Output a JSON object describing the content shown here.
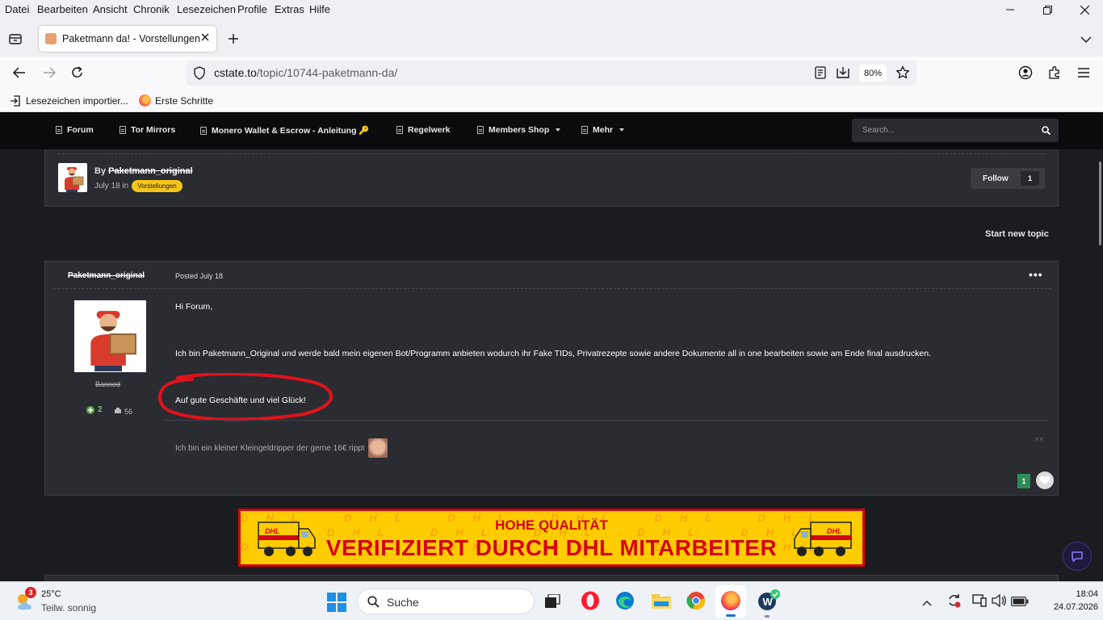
{
  "browser": {
    "menu": [
      "Datei",
      "Bearbeiten",
      "Ansicht",
      "Chronik",
      "Lesezeichen",
      "Profile",
      "Extras",
      "Hilfe"
    ],
    "tab_title": "Paketmann da! - Vorstellungen",
    "url_domain": "cstate.to",
    "url_path": "/topic/10744-paketmann-da/",
    "zoom": "80%",
    "bookmarks": [
      "Lesezeichen importier...",
      "Erste Schritte"
    ]
  },
  "site": {
    "nav": [
      "Forum",
      "Tor Mirrors",
      "Monero Wallet & Escrow - Anleitung 🔑",
      "Regelwerk",
      "Members Shop",
      "Mehr"
    ],
    "search_placeholder": "Search..."
  },
  "topic": {
    "by": "By",
    "author": "Paketmann_original",
    "date": "July 18 in",
    "category": "Vorstellungen",
    "follow_label": "Follow",
    "follow_count": "1",
    "start_new": "Start new topic"
  },
  "post": {
    "author": "Paketmann_original",
    "posted": "Posted July 18",
    "role": "Banned",
    "reputation": "2",
    "post_count": "56",
    "greeting": "Hi Forum,",
    "body": "Ich bin Paketmann_Original und werde bald mein eigenen Bot/Programm anbieten wodurch ihr Fake TIDs, Privatrezepte sowie andere Dokumente all in one bearbeiten sowie am Ende final ausdrucken.",
    "closing": "Auf gute Geschäfte und viel Glück!",
    "signature": "Ich bin ein kleiner Kleingeldripper der gerne 16€ rippt",
    "reaction_count": "1"
  },
  "banner": {
    "line1": "HOHE QUALITÄT",
    "line2": "VERIFIZIERT DURCH DHL MITARBEITER",
    "logo": "DHL"
  },
  "taskbar": {
    "weather_temp": "25°C",
    "weather_desc": "Teilw. sonnig",
    "weather_badge": "3",
    "search": "Suche",
    "time": "18:04",
    "date": "24.07.2026"
  },
  "colors": {
    "accent": "#f5c518",
    "annotation": "#e0121a",
    "dhl_yellow": "#ffcc00",
    "dhl_red": "#d40511"
  }
}
